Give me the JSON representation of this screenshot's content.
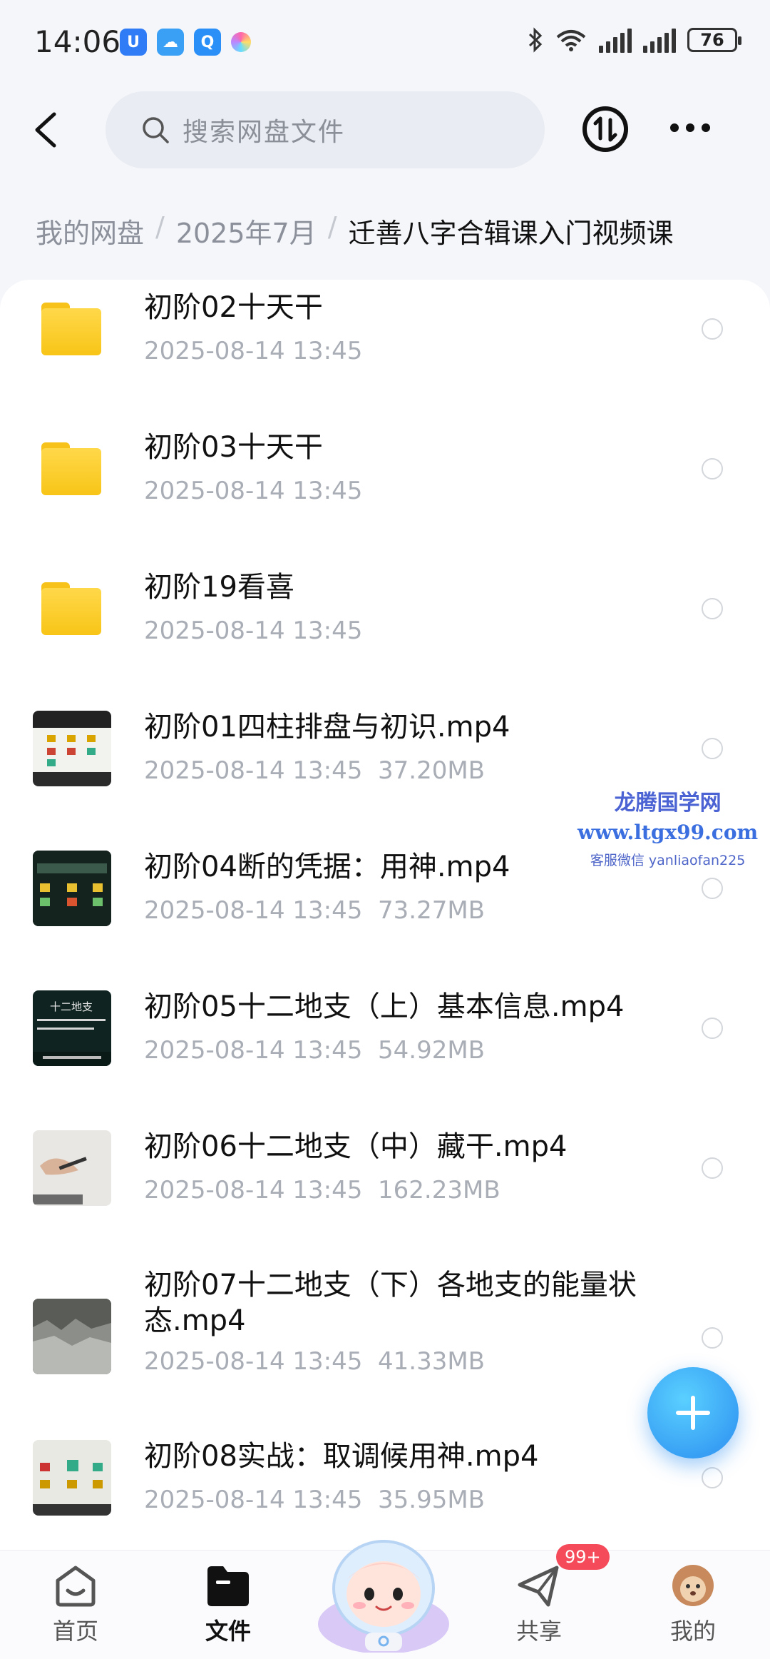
{
  "status": {
    "time": "14:06",
    "battery": "76"
  },
  "header": {
    "search_placeholder": "搜索网盘文件"
  },
  "breadcrumb": {
    "root": "我的网盘",
    "level2": "2025年7月",
    "current": "迁善八字合辑课入门视频课",
    "separator": "/"
  },
  "files": [
    {
      "name": "初阶02十天干",
      "date": "2025-08-14  13:45",
      "size": "",
      "kind": "folder"
    },
    {
      "name": "初阶03十天干",
      "date": "2025-08-14  13:45",
      "size": "",
      "kind": "folder"
    },
    {
      "name": "初阶19看喜",
      "date": "2025-08-14  13:45",
      "size": "",
      "kind": "folder"
    },
    {
      "name": "初阶01四柱排盘与初识.mp4",
      "date": "2025-08-14  13:45",
      "size": "37.20MB",
      "kind": "video"
    },
    {
      "name": "初阶04断的凭据：用神.mp4",
      "date": "2025-08-14  13:45",
      "size": "73.27MB",
      "kind": "video"
    },
    {
      "name": "初阶05十二地支（上）基本信息.mp4",
      "date": "2025-08-14  13:45",
      "size": "54.92MB",
      "kind": "video"
    },
    {
      "name": "初阶06十二地支（中）藏干.mp4",
      "date": "2025-08-14  13:45",
      "size": "162.23MB",
      "kind": "video"
    },
    {
      "name": "初阶07十二地支（下）各地支的能量状态.mp4",
      "date": "2025-08-14  13:45",
      "size": "41.33MB",
      "kind": "video"
    },
    {
      "name": "初阶08实战：取调候用神.mp4",
      "date": "2025-08-14  13:45",
      "size": "35.95MB",
      "kind": "video"
    }
  ],
  "thumb_text": {
    "t05": "十二地支"
  },
  "watermark": {
    "line1": "龙腾国学网",
    "line2": "www.ltgx99.com",
    "line3": "客服微信 yanliaofan225"
  },
  "nav": {
    "home": "首页",
    "files": "文件",
    "share": "共享",
    "mine": "我的",
    "share_badge": "99+"
  },
  "colors": {
    "accent": "#2b8df0",
    "folder": "#f8c517",
    "badge": "#f44a5a"
  }
}
